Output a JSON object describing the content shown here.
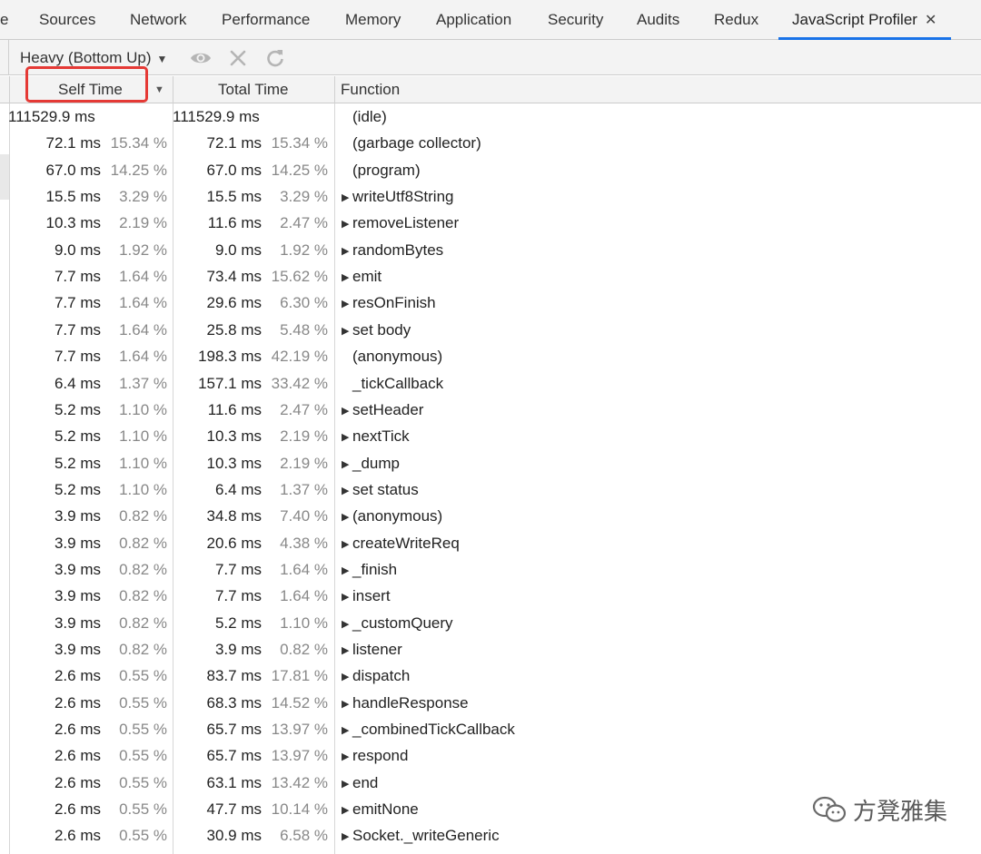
{
  "tabs": [
    {
      "label": "e"
    },
    {
      "label": "Sources"
    },
    {
      "label": "Network"
    },
    {
      "label": "Performance"
    },
    {
      "label": "Memory"
    },
    {
      "label": "Application"
    },
    {
      "label": "Security"
    },
    {
      "label": "Audits"
    },
    {
      "label": "Redux"
    },
    {
      "label": "JavaScript Profiler",
      "active": true
    }
  ],
  "tab_close_glyph": "✕",
  "toolbar": {
    "view_mode": "Heavy (Bottom Up)",
    "icons": [
      "eye-icon",
      "clear-icon",
      "reload-icon"
    ]
  },
  "columns": {
    "self_time": "Self Time",
    "total_time": "Total Time",
    "function": "Function"
  },
  "sort_indicator": "▼",
  "rows": [
    {
      "self": "111529.9 ms",
      "self_pct": "",
      "total": "111529.9 ms",
      "total_pct": "",
      "fn": "(idle)",
      "expandable": false
    },
    {
      "self": "72.1 ms",
      "self_pct": "15.34 %",
      "total": "72.1 ms",
      "total_pct": "15.34 %",
      "fn": "(garbage collector)",
      "expandable": false
    },
    {
      "self": "67.0 ms",
      "self_pct": "14.25 %",
      "total": "67.0 ms",
      "total_pct": "14.25 %",
      "fn": "(program)",
      "expandable": false
    },
    {
      "self": "15.5 ms",
      "self_pct": "3.29 %",
      "total": "15.5 ms",
      "total_pct": "3.29 %",
      "fn": "writeUtf8String",
      "expandable": true
    },
    {
      "self": "10.3 ms",
      "self_pct": "2.19 %",
      "total": "11.6 ms",
      "total_pct": "2.47 %",
      "fn": "removeListener",
      "expandable": true
    },
    {
      "self": "9.0 ms",
      "self_pct": "1.92 %",
      "total": "9.0 ms",
      "total_pct": "1.92 %",
      "fn": "randomBytes",
      "expandable": true
    },
    {
      "self": "7.7 ms",
      "self_pct": "1.64 %",
      "total": "73.4 ms",
      "total_pct": "15.62 %",
      "fn": "emit",
      "expandable": true
    },
    {
      "self": "7.7 ms",
      "self_pct": "1.64 %",
      "total": "29.6 ms",
      "total_pct": "6.30 %",
      "fn": "resOnFinish",
      "expandable": true
    },
    {
      "self": "7.7 ms",
      "self_pct": "1.64 %",
      "total": "25.8 ms",
      "total_pct": "5.48 %",
      "fn": "set body",
      "expandable": true
    },
    {
      "self": "7.7 ms",
      "self_pct": "1.64 %",
      "total": "198.3 ms",
      "total_pct": "42.19 %",
      "fn": "(anonymous)",
      "expandable": false
    },
    {
      "self": "6.4 ms",
      "self_pct": "1.37 %",
      "total": "157.1 ms",
      "total_pct": "33.42 %",
      "fn": "_tickCallback",
      "expandable": false
    },
    {
      "self": "5.2 ms",
      "self_pct": "1.10 %",
      "total": "11.6 ms",
      "total_pct": "2.47 %",
      "fn": "setHeader",
      "expandable": true
    },
    {
      "self": "5.2 ms",
      "self_pct": "1.10 %",
      "total": "10.3 ms",
      "total_pct": "2.19 %",
      "fn": "nextTick",
      "expandable": true
    },
    {
      "self": "5.2 ms",
      "self_pct": "1.10 %",
      "total": "10.3 ms",
      "total_pct": "2.19 %",
      "fn": "_dump",
      "expandable": true
    },
    {
      "self": "5.2 ms",
      "self_pct": "1.10 %",
      "total": "6.4 ms",
      "total_pct": "1.37 %",
      "fn": "set status",
      "expandable": true
    },
    {
      "self": "3.9 ms",
      "self_pct": "0.82 %",
      "total": "34.8 ms",
      "total_pct": "7.40 %",
      "fn": "(anonymous)",
      "expandable": true
    },
    {
      "self": "3.9 ms",
      "self_pct": "0.82 %",
      "total": "20.6 ms",
      "total_pct": "4.38 %",
      "fn": "createWriteReq",
      "expandable": true
    },
    {
      "self": "3.9 ms",
      "self_pct": "0.82 %",
      "total": "7.7 ms",
      "total_pct": "1.64 %",
      "fn": "_finish",
      "expandable": true
    },
    {
      "self": "3.9 ms",
      "self_pct": "0.82 %",
      "total": "7.7 ms",
      "total_pct": "1.64 %",
      "fn": "insert",
      "expandable": true
    },
    {
      "self": "3.9 ms",
      "self_pct": "0.82 %",
      "total": "5.2 ms",
      "total_pct": "1.10 %",
      "fn": "_customQuery",
      "expandable": true
    },
    {
      "self": "3.9 ms",
      "self_pct": "0.82 %",
      "total": "3.9 ms",
      "total_pct": "0.82 %",
      "fn": "listener",
      "expandable": true
    },
    {
      "self": "2.6 ms",
      "self_pct": "0.55 %",
      "total": "83.7 ms",
      "total_pct": "17.81 %",
      "fn": "dispatch",
      "expandable": true
    },
    {
      "self": "2.6 ms",
      "self_pct": "0.55 %",
      "total": "68.3 ms",
      "total_pct": "14.52 %",
      "fn": "handleResponse",
      "expandable": true
    },
    {
      "self": "2.6 ms",
      "self_pct": "0.55 %",
      "total": "65.7 ms",
      "total_pct": "13.97 %",
      "fn": "_combinedTickCallback",
      "expandable": true
    },
    {
      "self": "2.6 ms",
      "self_pct": "0.55 %",
      "total": "65.7 ms",
      "total_pct": "13.97 %",
      "fn": "respond",
      "expandable": true
    },
    {
      "self": "2.6 ms",
      "self_pct": "0.55 %",
      "total": "63.1 ms",
      "total_pct": "13.42 %",
      "fn": "end",
      "expandable": true
    },
    {
      "self": "2.6 ms",
      "self_pct": "0.55 %",
      "total": "47.7 ms",
      "total_pct": "10.14 %",
      "fn": "emitNone",
      "expandable": true
    },
    {
      "self": "2.6 ms",
      "self_pct": "0.55 %",
      "total": "30.9 ms",
      "total_pct": "6.58 %",
      "fn": "Socket._writeGeneric",
      "expandable": true
    }
  ],
  "watermark": {
    "text": "方凳雅集",
    "icon": "wechat-icon"
  },
  "colors": {
    "highlight": "#e53935",
    "active_tab_underline": "#1a73e8",
    "percent_text": "#888888"
  }
}
